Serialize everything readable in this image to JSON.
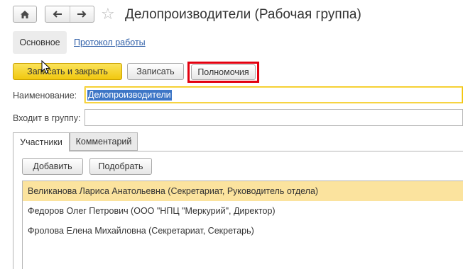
{
  "header": {
    "title": "Делопроизводители (Рабочая группа)"
  },
  "nav": {
    "main_tab": "Основное",
    "log_link": "Протокол работы"
  },
  "toolbar": {
    "save_close": "Записать и закрыть",
    "save": "Записать",
    "permissions": "Полномочия"
  },
  "form": {
    "name_label": "Наименование:",
    "name_value": "Делопроизводители",
    "group_label": "Входит в группу:",
    "group_value": ""
  },
  "tabs": {
    "members": "Участники",
    "comment": "Комментарий"
  },
  "members": {
    "add": "Добавить",
    "pick": "Подобрать",
    "rows": [
      "Великанова Лариса Анатольевна (Секретариат, Руководитель отдела)",
      "Федоров Олег Петрович (ООО \"НПЦ \"Меркурий\", Директор)",
      "Фролова Елена Михайловна (Секретариат, Секретарь)"
    ]
  },
  "colors": {
    "primary_button": "#f1c80f",
    "highlight_frame": "#e3000f",
    "selected_row": "#fbe39e",
    "link": "#2f5fa8",
    "text_selection": "#3d76c6"
  },
  "icons": [
    "home-icon",
    "back-arrow-icon",
    "forward-arrow-icon",
    "star-icon",
    "mouse-cursor-icon"
  ]
}
